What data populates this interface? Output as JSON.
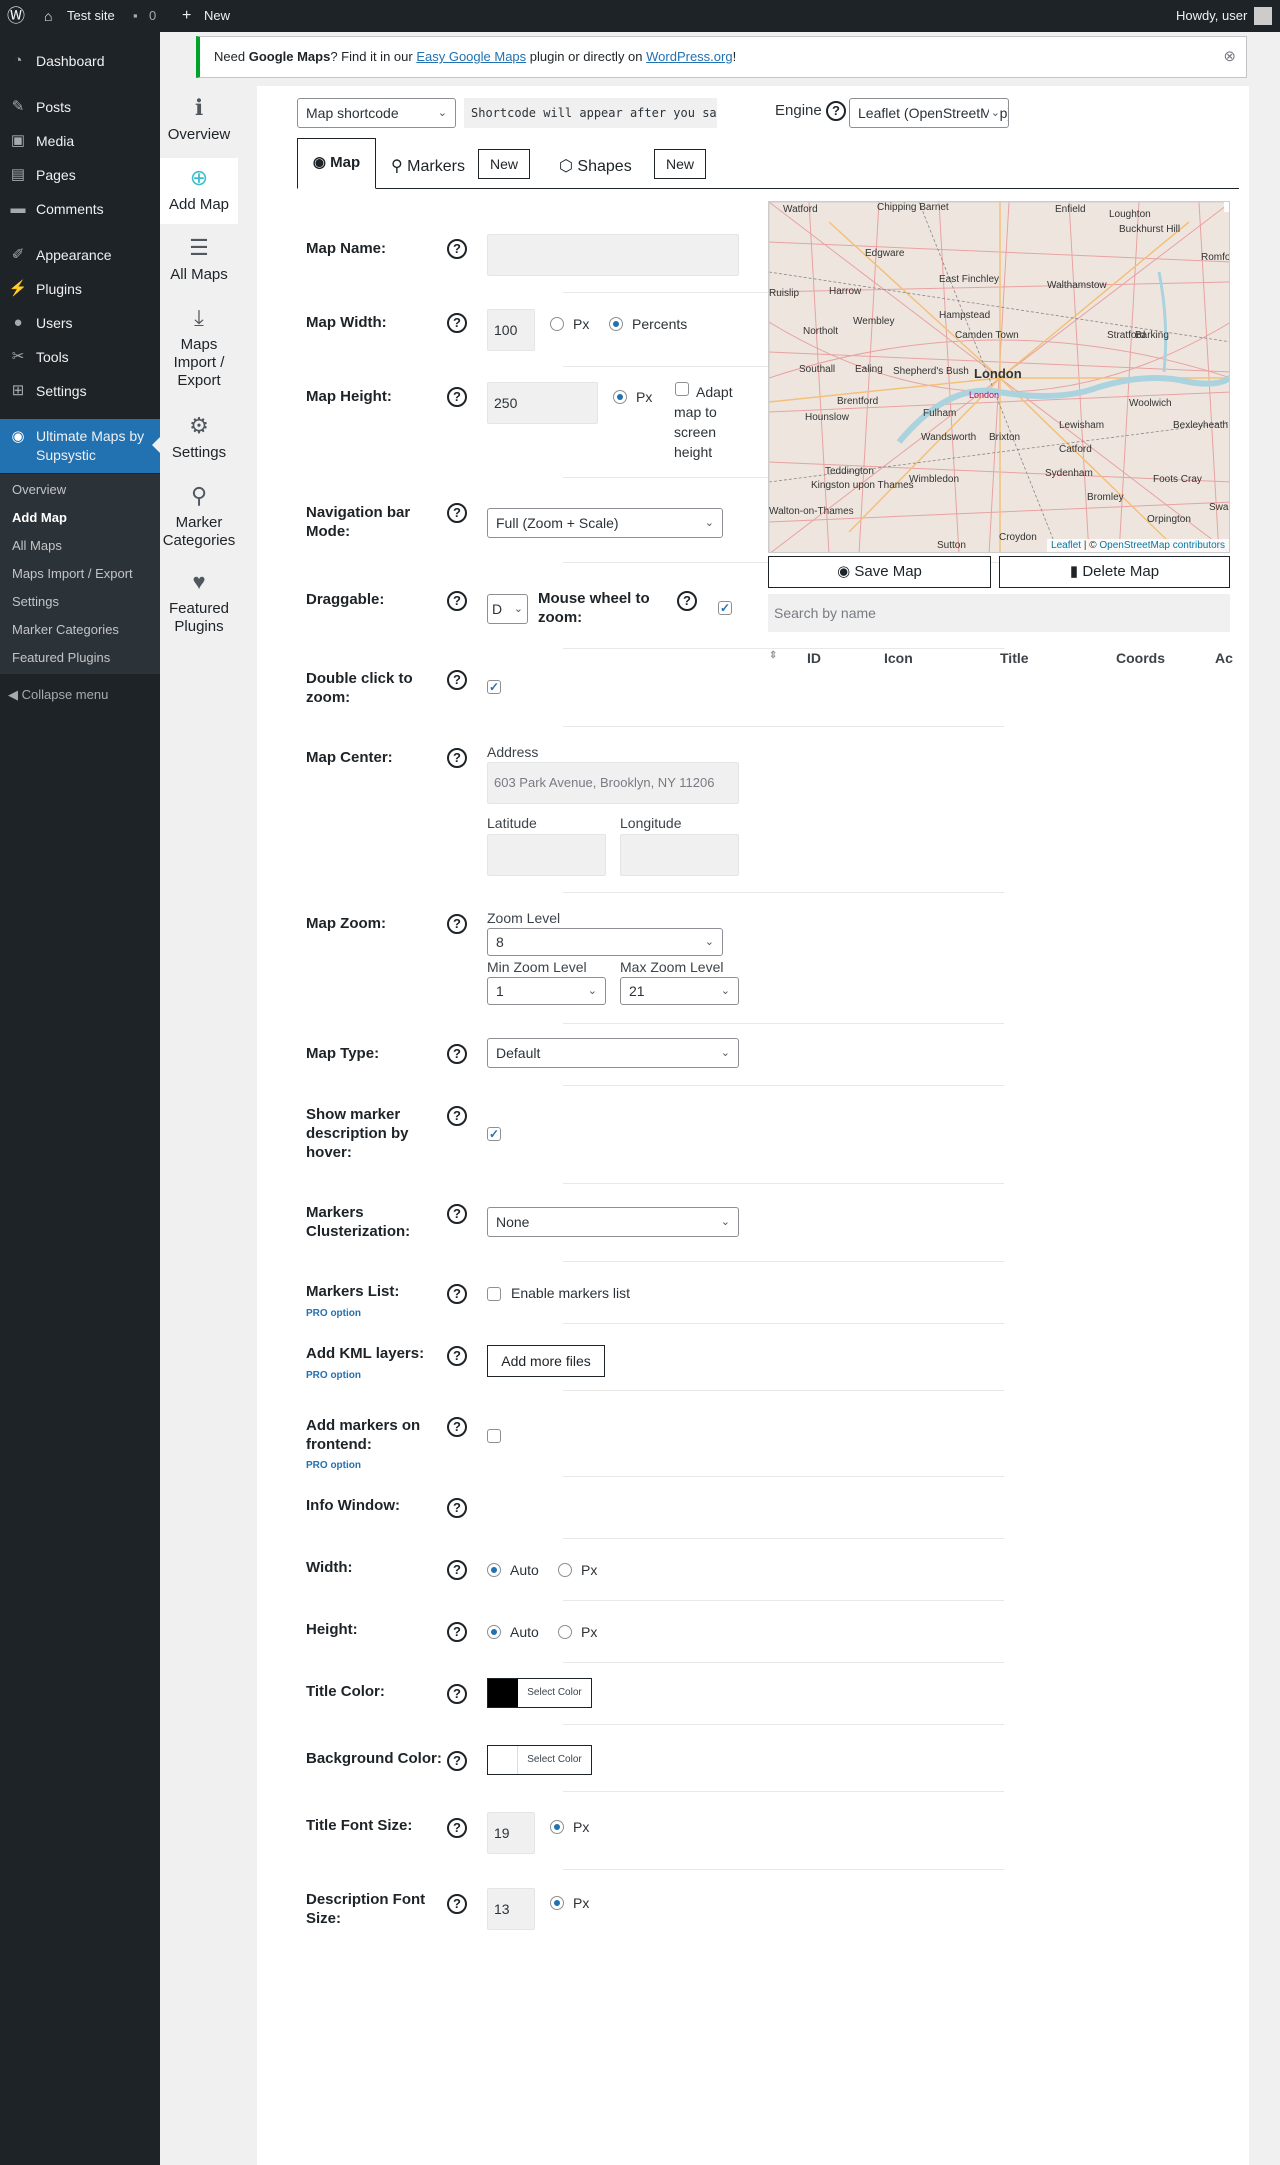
{
  "adminbar": {
    "site": "Test site",
    "comments": "0",
    "new": "New",
    "howdy": "Howdy, user"
  },
  "menu": {
    "items": [
      {
        "label": "Dashboard",
        "icon": "dashboard-icon"
      },
      {
        "label": "Posts",
        "icon": "pin-icon"
      },
      {
        "label": "Media",
        "icon": "media-icon"
      },
      {
        "label": "Pages",
        "icon": "pages-icon"
      },
      {
        "label": "Comments",
        "icon": "comments-icon"
      },
      {
        "label": "Appearance",
        "icon": "brush-icon"
      },
      {
        "label": "Plugins",
        "icon": "plug-icon"
      },
      {
        "label": "Users",
        "icon": "users-icon"
      },
      {
        "label": "Tools",
        "icon": "wrench-icon"
      },
      {
        "label": "Settings",
        "icon": "settings-icon"
      }
    ],
    "active": {
      "label": "Ultimate Maps by Supsystic",
      "icon": "globe-icon"
    },
    "submenu": [
      "Overview",
      "Add Map",
      "All Maps",
      "Maps Import / Export",
      "Settings",
      "Marker Categories",
      "Featured Plugins"
    ],
    "collapse": "Collapse menu"
  },
  "notice": {
    "pre": "Need ",
    "bold": "Google Maps",
    "mid": "? Find it in our ",
    "link1": "Easy Google Maps",
    "mid2": " plugin or directly on ",
    "link2": "WordPress.org",
    "post": "!"
  },
  "pluginnav": [
    {
      "label": "Overview",
      "icon": "info-icon"
    },
    {
      "label": "Add Map",
      "icon": "plus-circle-icon"
    },
    {
      "label": "All Maps",
      "icon": "list-icon"
    },
    {
      "label": "Maps Import / Export",
      "icon": "download-icon"
    },
    {
      "label": "Settings",
      "icon": "gear-icon"
    },
    {
      "label": "Marker Categories",
      "icon": "map-marker-icon"
    },
    {
      "label": "Featured Plugins",
      "icon": "heart-icon"
    }
  ],
  "top": {
    "shortcode_select": "Map shortcode",
    "shortcode_text": "Shortcode will appear after you save",
    "engine_label": "Engine",
    "engine_value": "Leaflet (OpenStreetMap)"
  },
  "tabs": {
    "map": "Map",
    "markers": "Markers",
    "shapes": "Shapes",
    "new": "New"
  },
  "form": {
    "map_name": "Map Name:",
    "map_width": "Map Width:",
    "map_width_value": "100",
    "px": "Px",
    "percents": "Percents",
    "map_height": "Map Height:",
    "map_height_value": "250",
    "adapt": "Adapt map to screen height",
    "nav_mode": "Navigation bar Mode:",
    "nav_mode_value": "Full (Zoom + Scale)",
    "draggable": "Draggable:",
    "draggable_value": "D",
    "mouse_wheel": "Mouse wheel to zoom:",
    "dblclick": "Double click to zoom:",
    "center": "Map Center:",
    "address_label": "Address",
    "address_placeholder": "603 Park Avenue, Brooklyn, NY 11206",
    "lat_label": "Latitude",
    "lng_label": "Longitude",
    "zoom": "Map Zoom:",
    "zoom_level_label": "Zoom Level",
    "zoom_level": "8",
    "min_zoom_label": "Min Zoom Level",
    "min_zoom": "1",
    "max_zoom_label": "Max Zoom Level",
    "max_zoom": "21",
    "type": "Map Type:",
    "type_value": "Default",
    "hover": "Show marker description by hover:",
    "cluster": "Markers Clusterization:",
    "cluster_value": "None",
    "markers_list": "Markers List:",
    "enable_list": "Enable markers list",
    "pro": "PRO option",
    "kml": "Add KML layers:",
    "kml_btn": "Add more files",
    "frontend": "Add markers on frontend:",
    "info": "Info Window:",
    "width": "Width:",
    "auto": "Auto",
    "height": "Height:",
    "title_color": "Title Color:",
    "select_color": "Select Color",
    "title_color_hex": "#000000",
    "bg_color": "Background Color:",
    "bg_color_hex": "#ffffff",
    "title_font": "Title Font Size:",
    "title_font_value": "19",
    "desc_font": "Description Font Size:",
    "desc_font_value": "13"
  },
  "map": {
    "labels": [
      "Watford",
      "Chipping Barnet",
      "Enfield",
      "Loughton",
      "Buckhurst Hill",
      "Edgware",
      "Harrow",
      "East Finchley",
      "Walthamstow",
      "Romford",
      "Ruislip",
      "Wembley",
      "Hampstead",
      "Camden Town",
      "Stratford",
      "Barking",
      "Northolt",
      "Southall",
      "Ealing",
      "Shepherd's Bush",
      "London",
      "Brentford",
      "Fulham",
      "London",
      "Woolwich",
      "Hounslow",
      "Wandsworth",
      "Brixton",
      "Lewisham",
      "Bexleyheath",
      "Catford",
      "Teddington",
      "Kingston upon Thames",
      "Wimbledon",
      "Sydenham",
      "Foots Cray",
      "Bromley",
      "Orpington",
      "Walton-on-Thames",
      "Croydon",
      "Sutton",
      "Swanley"
    ],
    "attribution_leaflet": "Leaflet",
    "attribution_sep": " | © ",
    "attribution_osm": "OpenStreetMap contributors"
  },
  "actions": {
    "save": "Save Map",
    "delete": "Delete Map",
    "search_placeholder": "Search by name"
  },
  "table": {
    "headers": [
      "ID",
      "Icon",
      "Title",
      "Coords",
      "Ac"
    ]
  }
}
